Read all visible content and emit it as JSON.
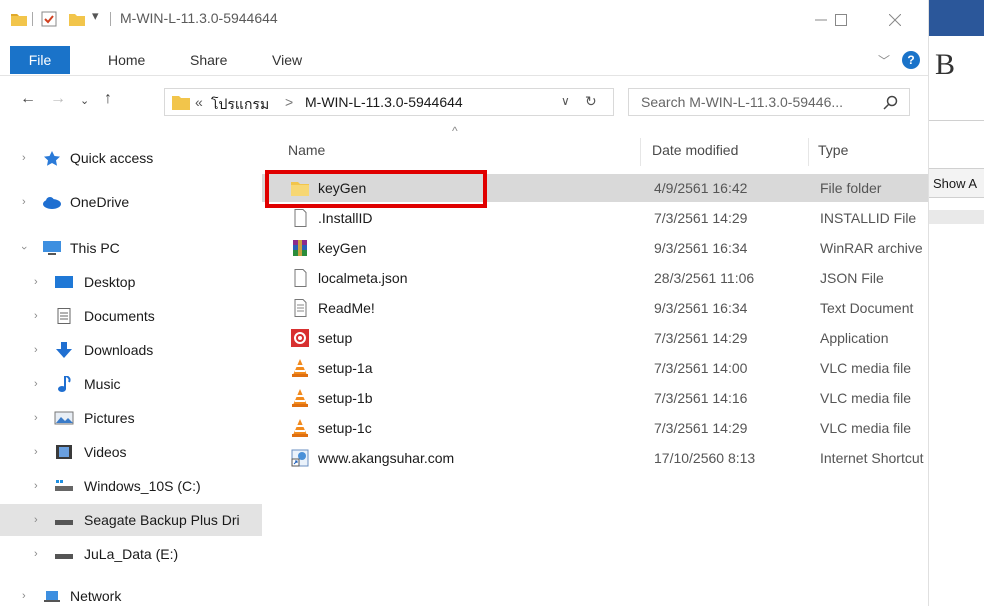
{
  "window": {
    "title": "M-WIN-L-11.3.0-5944644"
  },
  "ribbon": {
    "tabs": [
      "File",
      "Home",
      "Share",
      "View"
    ]
  },
  "address": {
    "crumbs": [
      "«",
      "โปรแกรม",
      ">",
      "M-WIN-L-11.3.0-5944644"
    ],
    "search_placeholder": "Search M-WIN-L-11.3.0-59446..."
  },
  "sidebar": {
    "items": [
      {
        "label": "Quick access",
        "icon": "star-icon"
      },
      {
        "label": "OneDrive",
        "icon": "cloud-icon"
      },
      {
        "label": "This PC",
        "icon": "pc-icon"
      },
      {
        "label": "Desktop",
        "icon": "desktop-icon"
      },
      {
        "label": "Documents",
        "icon": "documents-icon"
      },
      {
        "label": "Downloads",
        "icon": "download-icon"
      },
      {
        "label": "Music",
        "icon": "music-icon"
      },
      {
        "label": "Pictures",
        "icon": "pictures-icon"
      },
      {
        "label": "Videos",
        "icon": "videos-icon"
      },
      {
        "label": "Windows_10S (C:)",
        "icon": "drive-icon"
      },
      {
        "label": "Seagate Backup Plus Dri",
        "icon": "drive-icon"
      },
      {
        "label": "JuLa_Data (E:)",
        "icon": "drive-icon"
      },
      {
        "label": "Network",
        "icon": "network-icon"
      }
    ]
  },
  "columns": {
    "name": "Name",
    "date": "Date modified",
    "type": "Type"
  },
  "files": [
    {
      "name": "keyGen",
      "date": "4/9/2561 16:42",
      "type": "File folder",
      "icon": "folder-icon"
    },
    {
      "name": ".InstallID",
      "date": "7/3/2561 14:29",
      "type": "INSTALLID File",
      "icon": "blank-file-icon"
    },
    {
      "name": "keyGen",
      "date": "9/3/2561 16:34",
      "type": "WinRAR archive",
      "icon": "winrar-icon"
    },
    {
      "name": "localmeta.json",
      "date": "28/3/2561 11:06",
      "type": "JSON File",
      "icon": "blank-file-icon"
    },
    {
      "name": "ReadMe!",
      "date": "9/3/2561 16:34",
      "type": "Text Document",
      "icon": "text-file-icon"
    },
    {
      "name": "setup",
      "date": "7/3/2561 14:29",
      "type": "Application",
      "icon": "setup-app-icon"
    },
    {
      "name": "setup-1a",
      "date": "7/3/2561 14:00",
      "type": "VLC media file",
      "icon": "vlc-icon"
    },
    {
      "name": "setup-1b",
      "date": "7/3/2561 14:16",
      "type": "VLC media file",
      "icon": "vlc-icon"
    },
    {
      "name": "setup-1c",
      "date": "7/3/2561 14:29",
      "type": "VLC media file",
      "icon": "vlc-icon"
    },
    {
      "name": "www.akangsuhar.com",
      "date": "17/10/2560 8:13",
      "type": "Internet Shortcut",
      "icon": "shortcut-icon"
    }
  ],
  "background_app": {
    "letter": "B",
    "show_label": "Show A"
  },
  "colors": {
    "accent": "#1a73c9",
    "highlight": "#e00000",
    "selected_row": "#d9d9d9"
  }
}
